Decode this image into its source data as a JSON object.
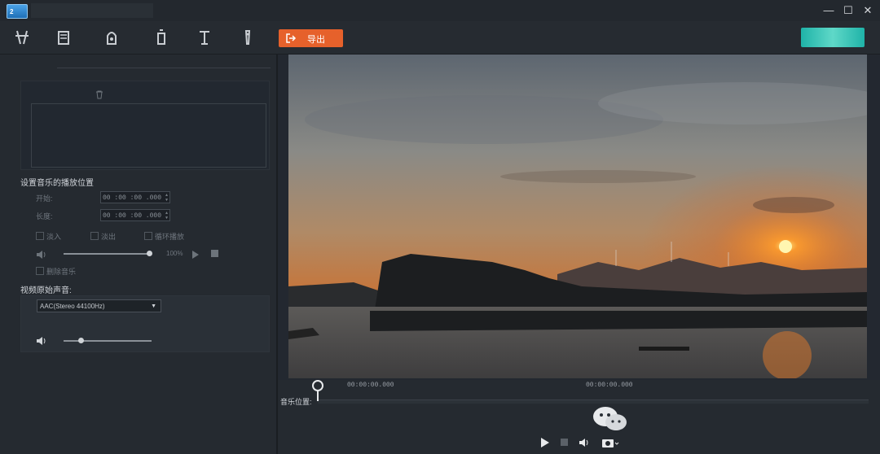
{
  "window": {
    "logo_text": "2",
    "controls": [
      "—",
      "☐",
      "✕"
    ]
  },
  "toolbar": {
    "tools": [
      {
        "icon": "trim-tool-icon"
      },
      {
        "icon": "crop-tool-icon"
      },
      {
        "icon": "text-tool-icon"
      },
      {
        "icon": "effect-tool-icon"
      },
      {
        "icon": "filter-tool-icon"
      },
      {
        "icon": "watermark-tool-icon"
      }
    ],
    "export_label": "导出",
    "export_color": "#e6612b"
  },
  "music_settings": {
    "section_title": "设置音乐的播放位置",
    "start_label": "开始:",
    "start_value": "00 :00 :00 .000",
    "length_label": "长度:",
    "length_value": "00 :00 :00 .000",
    "fade_in_label": "淡入",
    "fade_out_label": "淡出",
    "loop_label": "循环播放",
    "volume_percent": "100%",
    "volume_level": 1.0,
    "remove_music_label": "删除音乐"
  },
  "original_audio": {
    "section_title": "视频原始声音:",
    "codec_selected": "AAC(Stereo 44100Hz)",
    "volume_level": 0.2
  },
  "timeline": {
    "start_time": "00:00:00.000",
    "end_time": "00:00:00.000",
    "music_position_label": "音乐位置:",
    "playhead_fraction": 0.0
  },
  "player": {
    "play_icon": "play-icon",
    "stop_icon": "stop-icon",
    "volume_icon": "volume-icon",
    "snapshot_icon": "camera-icon"
  }
}
